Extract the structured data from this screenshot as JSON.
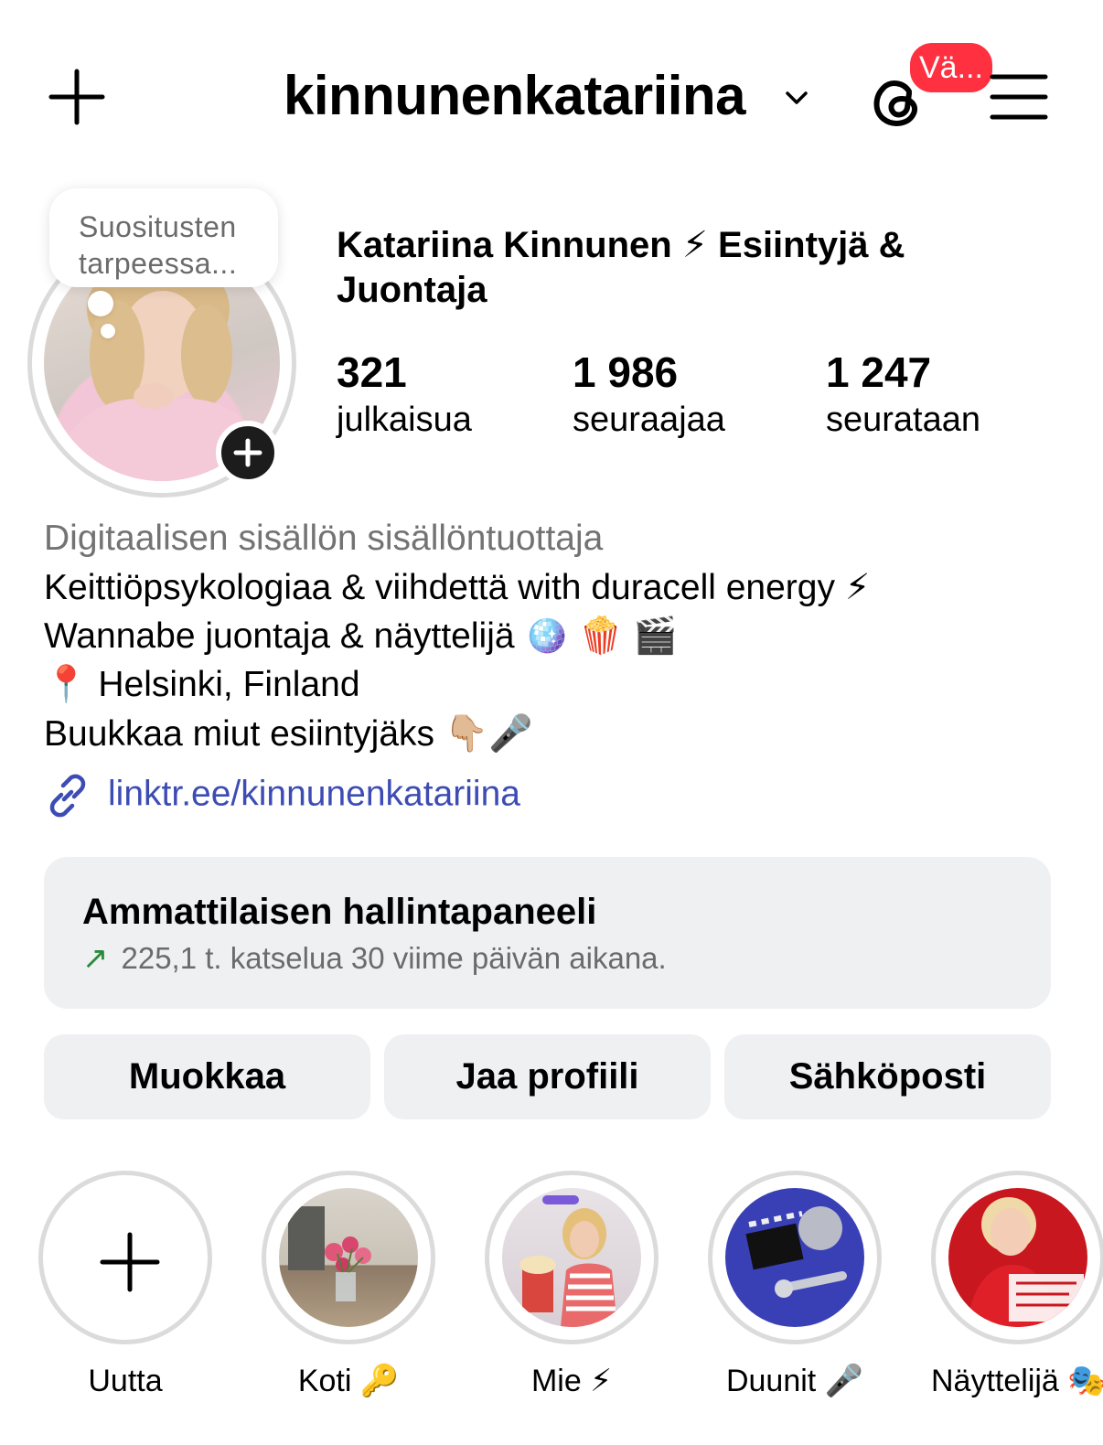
{
  "header": {
    "username": "kinnunenkatariina",
    "threads_badge": "Vä..."
  },
  "profile": {
    "note": "Suositusten tarpeessa...",
    "full_name": "Katariina Kinnunen ⚡ Esiintyjä & Juontaja",
    "stats": [
      {
        "value": "321",
        "label": "julkaisua"
      },
      {
        "value": "1 986",
        "label": "seuraajaa"
      },
      {
        "value": "1 247",
        "label": "seurataan"
      }
    ],
    "category": "Digitaalisen sisällön sisällöntuottaja",
    "bio_lines": [
      "Keittiöpsykologiaa & viihdettä with duracell energy ⚡",
      "Wannabe juontaja & näyttelijä 🪩 🍿 🎬",
      "📍 Helsinki, Finland",
      "Buukkaa miut esiintyjäks 👇🏼🎤"
    ],
    "link": "linktr.ee/kinnunenkatariina"
  },
  "dashboard": {
    "title": "Ammattilaisen hallintapaneeli",
    "subtitle": "225,1 t. katselua 30 viime päivän aikana."
  },
  "buttons": {
    "edit": "Muokkaa",
    "share": "Jaa profiili",
    "email": "Sähköposti"
  },
  "highlights": [
    {
      "label": "Uutta"
    },
    {
      "label": "Koti 🔑"
    },
    {
      "label": "Mie ⚡"
    },
    {
      "label": "Duunit 🎤"
    },
    {
      "label": "Näyttelijä 🎭"
    }
  ],
  "colors": {
    "badge": "#ff3040",
    "link": "#3d4cb4",
    "panel": "#eff0f2",
    "trend": "#2a8a3a"
  }
}
